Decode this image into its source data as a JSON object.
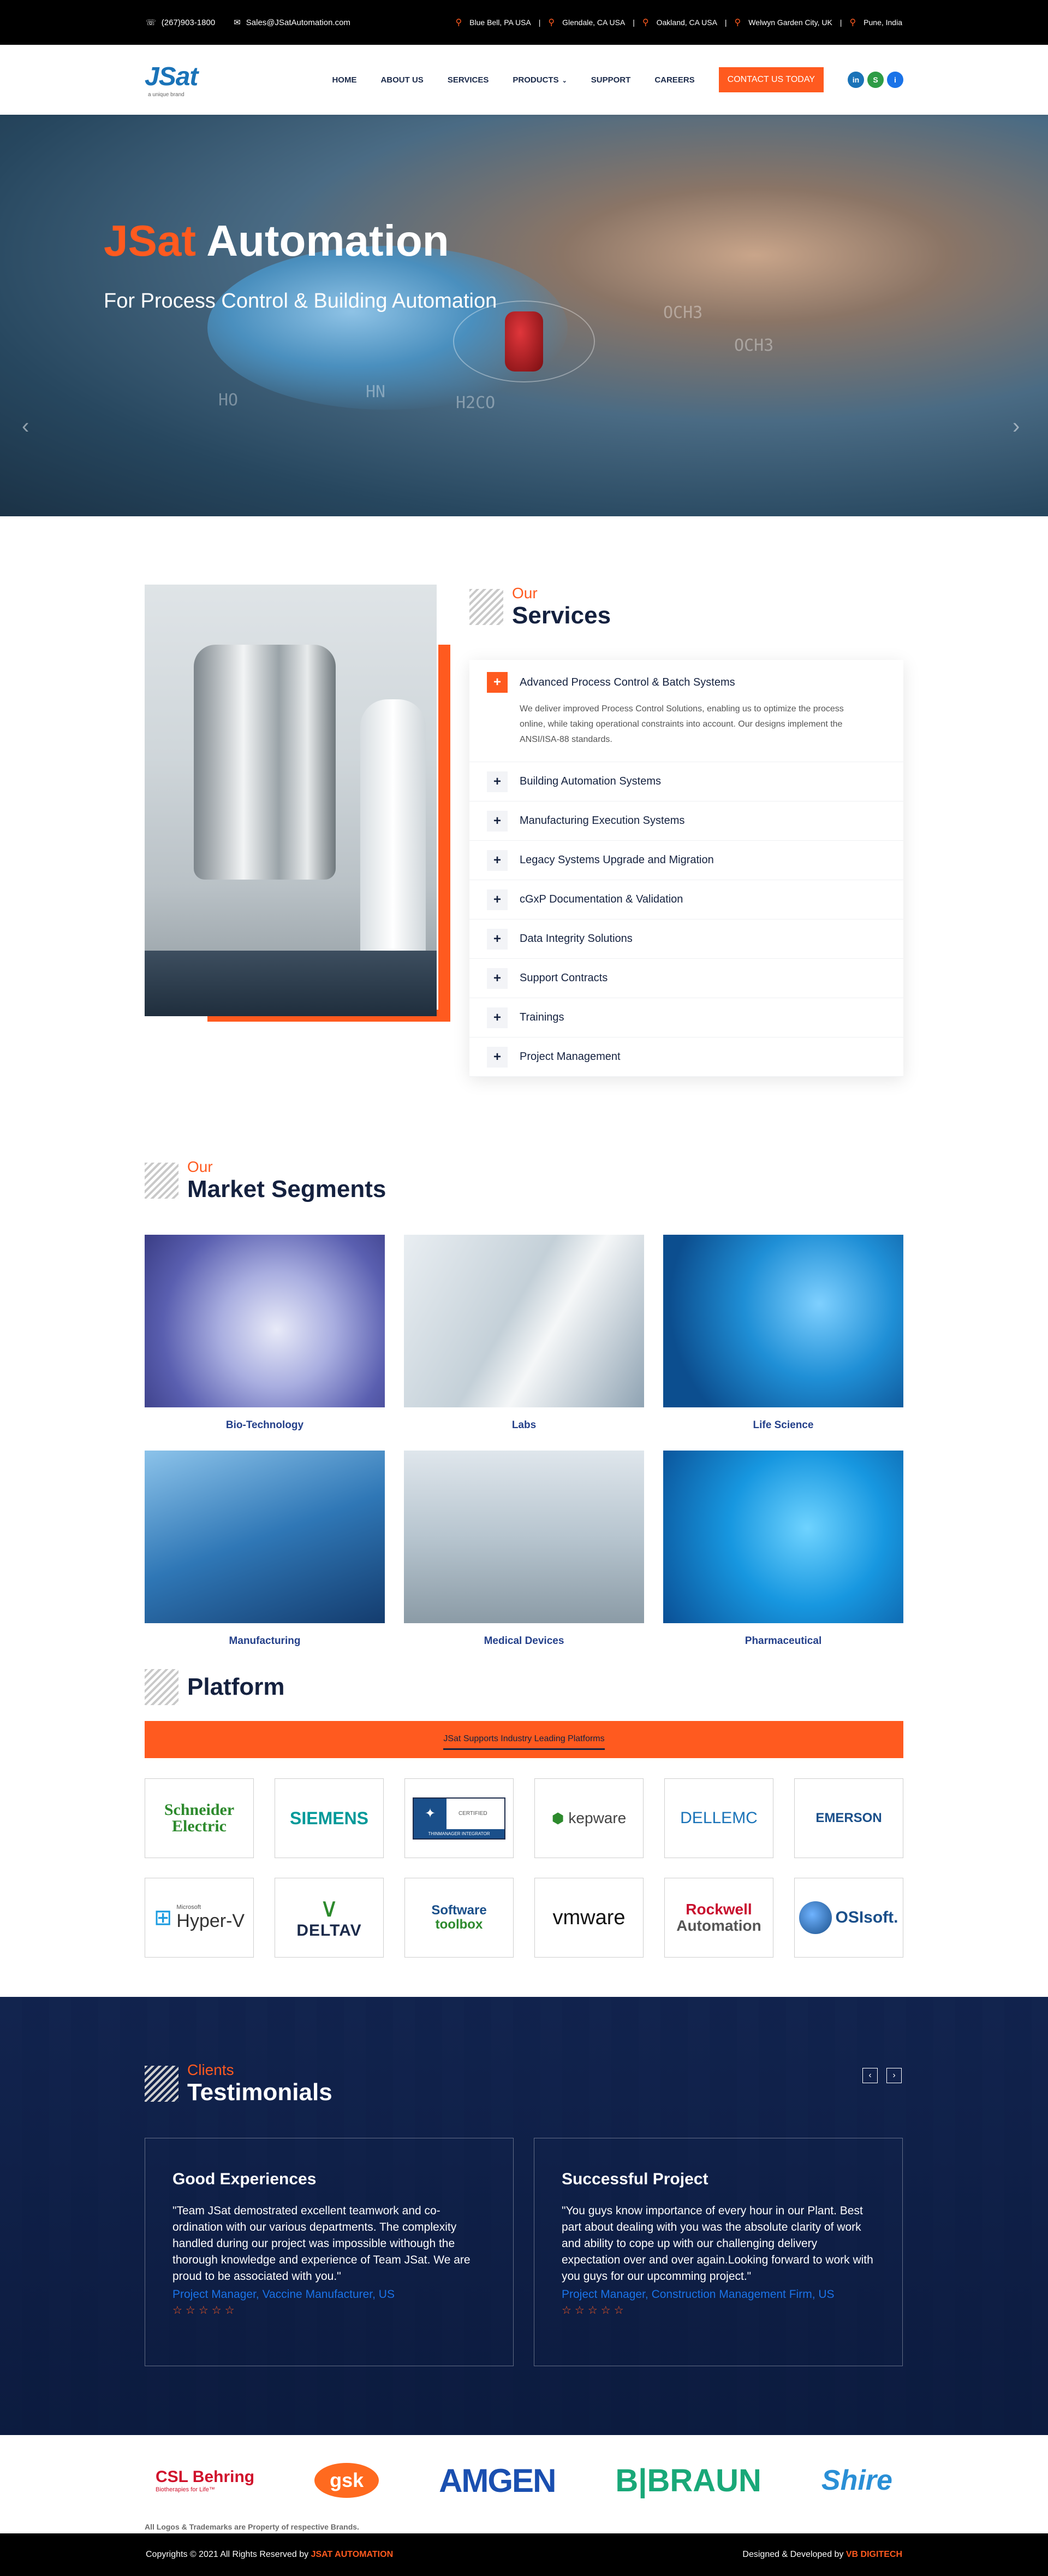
{
  "topbar": {
    "phone": "(267)903-1800",
    "email": "Sales@JSatAutomation.com",
    "locations": [
      "Blue Bell, PA USA",
      "Glendale, CA USA",
      "Oakland, CA USA",
      "Welwyn Garden City, UK",
      "Pune, India"
    ]
  },
  "header": {
    "logo": "JSat",
    "logo_tag": "a unique brand",
    "nav": [
      "HOME",
      "ABOUT US",
      "SERVICES",
      "PRODUCTS",
      "SUPPORT",
      "CAREERS"
    ],
    "cta": "CONTACT US TODAY",
    "social_icons": [
      "linkedin-icon",
      "skype-icon",
      "info-icon"
    ]
  },
  "hero": {
    "title_accent": "JSat",
    "title_rest": " Automation",
    "subtitle": "For Process Control & Building Automation",
    "chem_labels": [
      "OCH3",
      "OCH3",
      "HN",
      "H2CO",
      "HO"
    ]
  },
  "services": {
    "kicker": "Our",
    "title": "Services",
    "open_item": {
      "label": "Advanced Process Control & Batch Systems",
      "body": "We deliver improved Process Control Solutions, enabling us to optimize the process online, while taking operational constraints into account. Our designs implement the ANSI/ISA-88 standards."
    },
    "items": [
      "Building Automation Systems",
      "Manufacturing Execution Systems",
      "Legacy Systems Upgrade and Migration",
      "cGxP Documentation & Validation",
      "Data Integrity Solutions",
      "Support Contracts",
      "Trainings",
      "Project Management"
    ]
  },
  "market": {
    "kicker": "Our",
    "title": "Market Segments",
    "segments": [
      "Bio-Technology",
      "Labs",
      "Life Science",
      "Manufacturing",
      "Medical Devices",
      "Pharmaceutical"
    ]
  },
  "platform": {
    "title": "Platform",
    "tab": "JSat Supports Industry Leading Platforms",
    "logos": [
      "Schneider Electric",
      "SIEMENS",
      "CERTIFIED",
      "kepware",
      "DELLEMC",
      "EMERSON",
      "Hyper-V",
      "DELTAV",
      "Software toolbox",
      "vmware",
      "Rockwell Automation",
      "OSIsoft."
    ],
    "logos_extra": {
      "microsoft": "Microsoft",
      "rockwell_line1": "Rockwell",
      "rockwell_line2": "Automation",
      "schneider_line1": "Schneider",
      "schneider_line2": "Electric",
      "toolbox_line1": "Software",
      "toolbox_line2": "toolbox",
      "certified_sub": "THINMANAGER INTEGRATOR"
    }
  },
  "testimonials": {
    "kicker": "Clients",
    "title": "Testimonials",
    "cards": [
      {
        "title": "Good Experiences",
        "quote": "\"Team JSat demostrated excellent teamwork and co-ordination with our various departments. The complexity handled during our project was impossible withough the thorough knowledge and experience of Team JSat. We are proud to be associated with you.\"",
        "author": "Project Manager, Vaccine Manufacturer, US",
        "stars": "☆☆☆☆☆"
      },
      {
        "title": "Successful Project",
        "quote": "\"You guys know importance of every hour in our Plant. Best part about dealing with you was the absolute clarity of work and ability to cope up with our challenging delivery expectation over and over again.Looking forward to work with you guys for our upcomming project.\"",
        "author": "Project Manager, Construction Management Firm, US",
        "stars": "☆☆☆☆☆"
      }
    ]
  },
  "clients": {
    "logos": [
      "CSL Behring",
      "gsk",
      "AMGEN",
      "B|BRAUN",
      "Shire"
    ],
    "csl_sub": "Biotherapies for Life™",
    "trademark": "All Logos & Trademarks are Property of respective Brands."
  },
  "footer": {
    "copyright": "Copyrights © 2021 All Rights Reserved by ",
    "company": "JSAT AUTOMATION",
    "designed": "Designed & Developed by ",
    "designer": "VB DIGITECH"
  },
  "colors": {
    "accent": "#ff5a1f",
    "navy": "#14213f",
    "link_blue": "#24408a"
  }
}
